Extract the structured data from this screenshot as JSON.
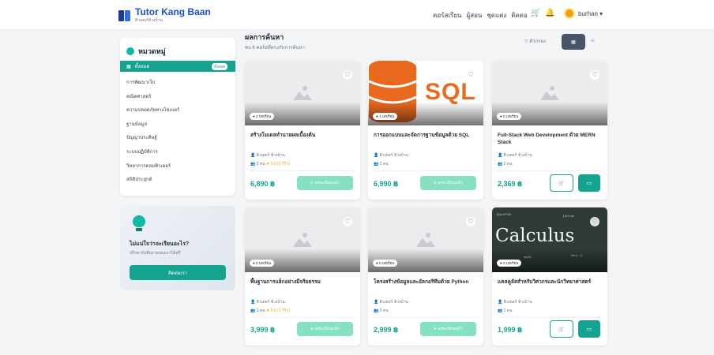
{
  "brand": {
    "name": "Tutor Kang Baan",
    "tagline": "ติวเตอร์ข้างบ้าน"
  },
  "nav": {
    "items": [
      "คอร์สเรียน",
      "ผู้สอน",
      "ชุดแต่ง",
      "ติดต่อ"
    ],
    "username": "burhan ▾"
  },
  "sidebar": {
    "title": "หมวดหมู่",
    "active": "ทั้งหมด",
    "active_badge": "ทั้งหมด",
    "items": [
      "การพัฒนาเว็บ",
      "คณิตศาสตร์",
      "ความปลอดภัยทางไซเบอร์",
      "ฐานข้อมูล",
      "ปัญญาประดิษฐ์",
      "ระบบปฏิบัติการ",
      "วิทยาการคอมพิวเตอร์",
      "สถิติประยุกต์"
    ]
  },
  "promo": {
    "title": "ไม่แน่ใจว่าจะเรียนอะไร?",
    "subtitle": "ปรึกษากับทีมงานของเราได้ฟรี",
    "button": "ติดต่อเรา"
  },
  "results": {
    "title": "ผลการค้นหา",
    "subtitle": "พบ 6 คอร์สที่ตรงกับการค้นหา"
  },
  "toolbar": {
    "filter": "▽ ตัวกรอง",
    "grid": "▦",
    "list": "≡"
  },
  "courses": [
    {
      "lessons": "● 2 บทเรียน",
      "title": "สร้างโมเดลทำนายผลเบื้องต้น",
      "instructor": "ติวเตอร์ ข้างบ้าน",
      "meta": "2 คน",
      "rating": "★ 5.0 (1 รีวิว)",
      "price": "6,890 ฿",
      "action": "● ลงทะเบียนแล้ว"
    },
    {
      "lessons": "● 1 บทเรียน",
      "title": "การออกแบบและจัดการฐานข้อมูลด้วย SQL",
      "instructor": "ติวเตอร์ ข้างบ้าน",
      "meta": "3 คน",
      "rating": "",
      "price": "6,990 ฿",
      "action": "● ลงทะเบียนแล้ว",
      "art_text": "SQL"
    },
    {
      "lessons": "● 0 บทเรียน",
      "title": "Full-Stack Web Development ด้วย MERN Stack",
      "instructor": "ติวเตอร์ ข้างบ้าน",
      "meta": "2 คน",
      "rating": "",
      "price": "2,369 ฿",
      "cart": "🛒",
      "buy": "▭"
    },
    {
      "lessons": "● 0 บทเรียน",
      "title": "พื้นฐานการแฮ็กอย่างมีจริยธรรม",
      "instructor": "ติวเตอร์ ข้างบ้าน",
      "meta": "2 คน",
      "rating": "★ 5.0 (1 รีวิว)",
      "price": "3,999 ฿",
      "action": "● ลงทะเบียนแล้ว"
    },
    {
      "lessons": "● 0 บทเรียน",
      "title": "โครงสร้างข้อมูลและอัลกอริทึมด้วย Python",
      "instructor": "ติวเตอร์ ข้างบ้าน",
      "meta": "2 คน",
      "rating": "",
      "price": "2,999 ฿",
      "action": "● ลงทะเบียนแล้ว"
    },
    {
      "lessons": "● 2 บทเรียน",
      "title": "แคลคูลัสสำหรับวิศวกรและนักวิทยาศาสตร์",
      "instructor": "ติวเตอร์ ข้างบ้าน",
      "meta": "1 คน",
      "rating": "",
      "price": "1,999 ฿",
      "cart": "🛒",
      "buy": "▭",
      "art_text": "Calculus"
    }
  ],
  "icons": {
    "cart": "🛒",
    "bell": "🔔",
    "heart": "♡",
    "user": "👤",
    "people": "👥"
  },
  "colors": {
    "accent": "#14a38f",
    "brand": "#1d4ed8",
    "enrolled": "#86e0c2",
    "sql": "#e9691f"
  }
}
